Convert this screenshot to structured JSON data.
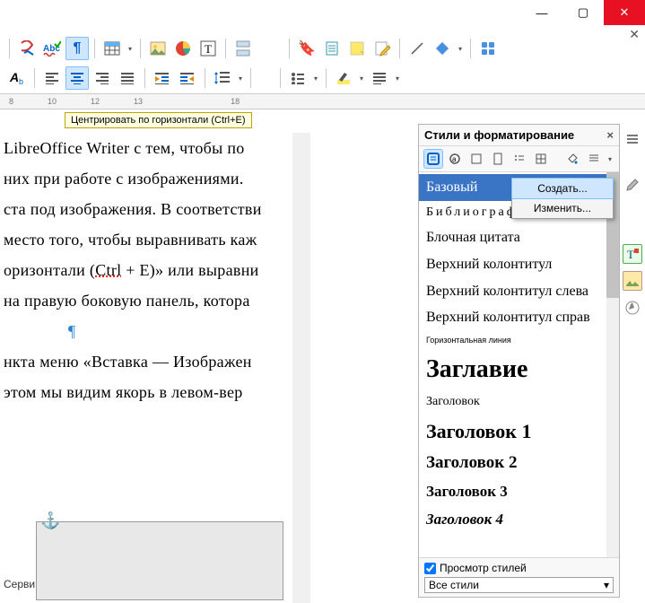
{
  "window": {
    "min": "—",
    "max": "▢",
    "close": "✕",
    "sub_close": "✕"
  },
  "toolbar1": {
    "pilcrow": "¶",
    "table": "▦",
    "pic": "🖼",
    "chart": "◔",
    "textbox": "T",
    "pagebreak": "≣",
    "bookmark": "🔖",
    "field": "📄",
    "note": "📝",
    "edit": "✎",
    "line": "／",
    "shape": "◆",
    "grid": "⊞"
  },
  "toolbar2": {
    "charcolor": "A",
    "sub": "b",
    "align_left": "≡",
    "align_center": "≡",
    "align_right": "≡",
    "align_just": "≡",
    "indent_dec": "⇤",
    "indent_inc": "⇥",
    "linespacing": "↕",
    "bullets": "•",
    "paragraph": "≡",
    "tableopts": "≡"
  },
  "ruler": [
    "8",
    "10",
    "12",
    "13",
    "18"
  ],
  "tooltip": "Центрировать по горизонтали (Ctrl+E)",
  "doc": [
    " LibreOffice Writer с тем, чтобы по",
    " них при работе с изображениями.",
    "",
    "ста под изображения. В соответстви",
    " место того, чтобы выравнивать каж",
    "оризонтали (Ctrl + E)» или выравни",
    "на правую боковую панель, котора",
    "",
    "¶",
    "",
    "нкта меню «Вставка — Изображен",
    " этом мы видим якорь в левом-вер"
  ],
  "servi": "Серви",
  "panel": {
    "title": "Стили и форматирование",
    "close": "×",
    "styles": [
      {
        "cls": "sel-row",
        "label": "Базовый"
      },
      {
        "cls": "biblio",
        "label": "Библиография"
      },
      {
        "cls": "",
        "label": "Блочная цитата"
      },
      {
        "cls": "",
        "label": "Верхний колонтитул"
      },
      {
        "cls": "",
        "label": "Верхний колонтитул слева"
      },
      {
        "cls": "",
        "label": "Верхний колонтитул справ"
      },
      {
        "cls": "hrzline",
        "label": "Горизонтальная линия"
      },
      {
        "cls": "zaglavie",
        "label": "Заглавие"
      },
      {
        "cls": "zh",
        "label": "Заголовок"
      },
      {
        "cls": "h1",
        "label": "Заголовок 1"
      },
      {
        "cls": "h2",
        "label": "Заголовок 2"
      },
      {
        "cls": "h3",
        "label": "Заголовок 3"
      },
      {
        "cls": "h4",
        "label": "Заголовок 4"
      }
    ],
    "preview": "Просмотр стилей",
    "filter": "Все стили"
  },
  "context": {
    "create": "Создать...",
    "modify": "Изменить..."
  }
}
